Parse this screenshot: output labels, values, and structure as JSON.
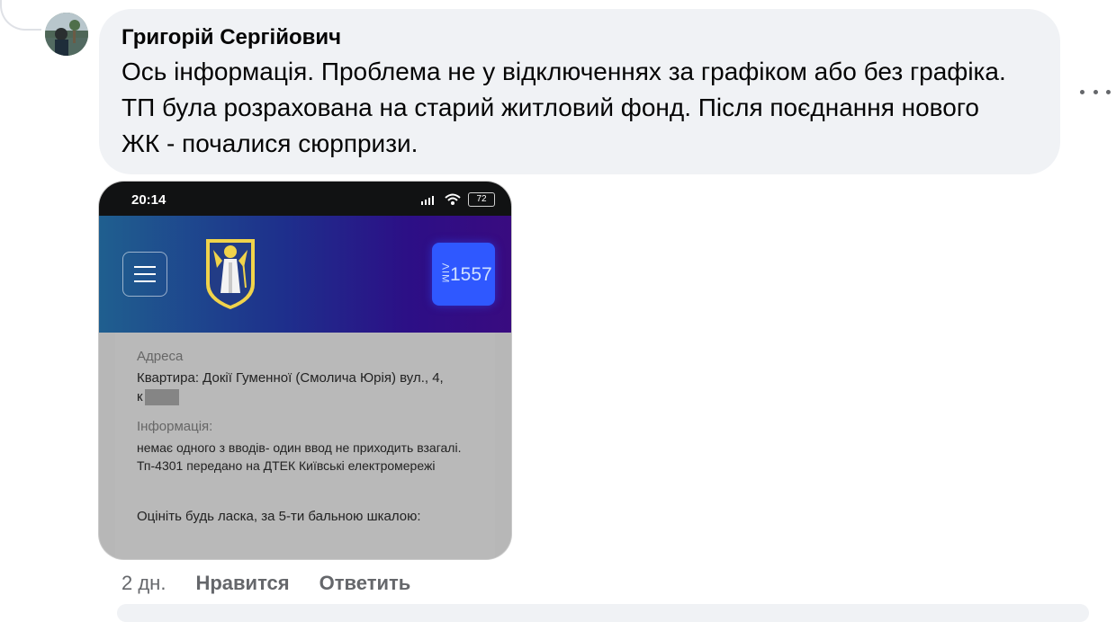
{
  "comment": {
    "author": "Григорій Сергійович",
    "text": "Ось інформація. Проблема не у відключеннях за графіком або без графіка. ТП була розрахована на старий житловий фонд. Після поєднання нового ЖК - почалися сюрпризи.",
    "more_icon": "more-horizontal-icon"
  },
  "attachment": {
    "status_bar": {
      "time": "20:14",
      "battery": "72"
    },
    "app_header": {
      "badge_vertical": "ΛΙΜ",
      "badge_number": "1557"
    },
    "content": {
      "address_label": "Адреса",
      "address_value": "Квартира: Докії Гуменної (Смолича Юрія) вул., 4,",
      "address_value_line2": "к",
      "info_label": "Інформація:",
      "info_value": "немає одного з вводів- один ввод не приходить взагалі. Тп-4301 передано на ДТЕК Київські електромережі",
      "rating_prompt": "Оцініть будь ласка, за 5-ти бальною шкалою:"
    }
  },
  "actions": {
    "time": "2 дн.",
    "like": "Нравится",
    "reply": "Ответить"
  }
}
